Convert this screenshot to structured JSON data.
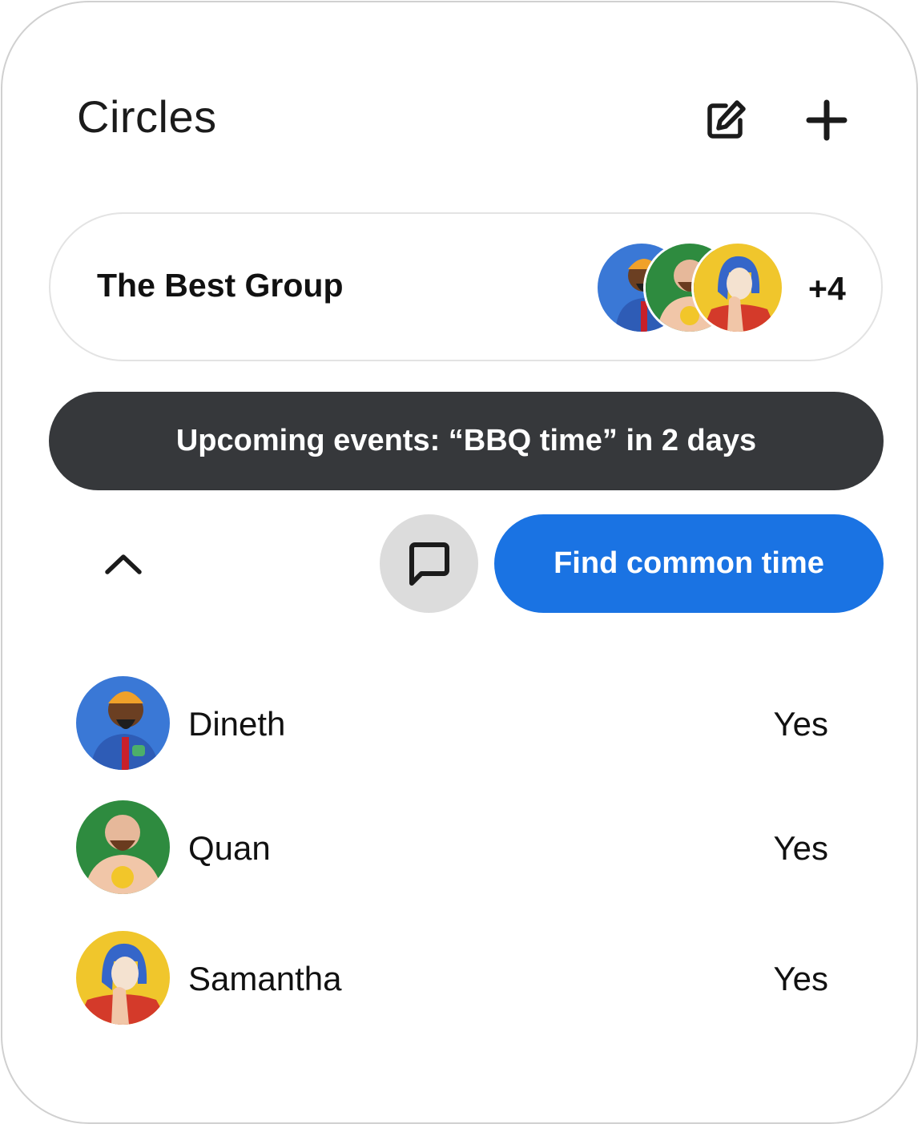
{
  "header": {
    "title": "Circles",
    "edit_icon": "edit-square-icon",
    "add_icon": "plus-icon"
  },
  "group": {
    "name": "The Best Group",
    "more_count": "+4",
    "avatar_colors": [
      "#2f6fd0",
      "#2a8f3e",
      "#f2c62a"
    ]
  },
  "event_banner": {
    "text": "Upcoming events: “BBQ time” in 2 days",
    "background": "#36383b"
  },
  "actions": {
    "collapse_icon": "chevron-up-icon",
    "chat_icon": "chat-bubble-icon",
    "find_label": "Find common time",
    "find_color": "#1a73e3"
  },
  "members": [
    {
      "name": "Dineth",
      "status": "Yes",
      "avatar_bg": "#3a78d6"
    },
    {
      "name": "Quan",
      "status": "Yes",
      "avatar_bg": "#2e8b3f"
    },
    {
      "name": "Samantha",
      "status": "Yes",
      "avatar_bg": "#f0c62c"
    }
  ]
}
